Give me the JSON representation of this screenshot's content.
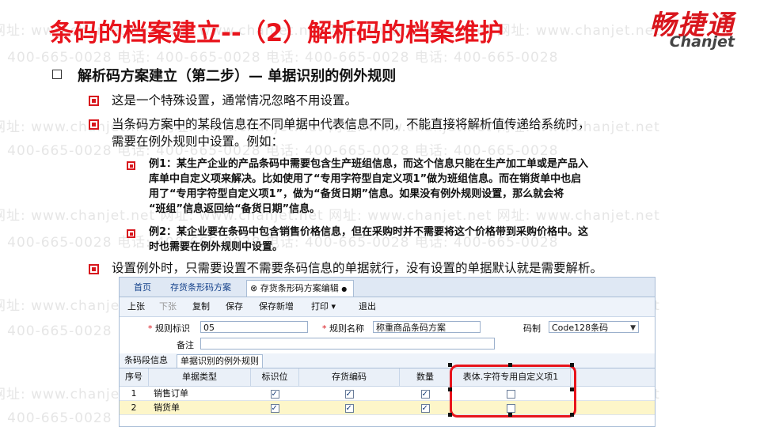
{
  "slide": {
    "title": "条码的档案建立--（2）解析码的档案维护",
    "logo_cn": "畅捷通",
    "logo_en": "Chanjet",
    "watermark": [
      "网址: www.chanjet.net",
      "电话: 400-665-0028"
    ],
    "heading": "解析码方案建立（第二步）— 单据识别的例外规则",
    "points": [
      "这是一个特殊设置，通常情况忽略不用设置。",
      "当条码方案中的某段信息在不同单据中代表信息不同，不能直接将解析值传递给系统时，",
      "需要在例外规则中设置。例如："
    ],
    "examples": [
      "例1：某生产企业的产品条码中需要包含生产班组信息，而这个信息只能在生产加工单或是产品入",
      "库单中自定义项来解决。比如使用了“专用字符型自定义项1”做为班组信息。而在销货单中也启",
      "用了“专用字符型自定义项1”，做为“备货日期”信息。如果没有例外规则设置，那么就会将",
      "“班组”信息返回给“备货日期”信息。",
      "例2：某企业要在条码中包含销售价格信息，但在采购时并不需要将这个价格带到采购价格中。这",
      "时也需要在例外规则中设置。"
    ],
    "last_point": "设置例外时，只需要设置不需要条码信息的单据就行，没有设置的单据默认就是需要解析。"
  },
  "app": {
    "tabs": [
      "首页",
      "存货条形码方案",
      "存货条形码方案编辑"
    ],
    "tab_close_glyph": "⊗",
    "toolbar": [
      "上张",
      "下张",
      "复制",
      "保存",
      "保存新增",
      "打印 ▾",
      "退出"
    ],
    "form": {
      "rule_id_label": "规则标识",
      "rule_id_value": "05",
      "rule_name_label": "规则名称",
      "rule_name_value": "称重商品条码方案",
      "codetype_label": "码制",
      "codetype_value": "Code128条码",
      "note_label": "备注",
      "required_mark": "*"
    },
    "subtabs": [
      "条码段信息",
      "单据识别的例外规则"
    ],
    "grid": {
      "headers": [
        "序号",
        "单据类型",
        "标识位",
        "存货编码",
        "数量",
        "表体.字符专用自定义项1"
      ],
      "rows": [
        {
          "no": "1",
          "type": "销售订单",
          "flags": [
            true,
            true,
            true,
            false
          ]
        },
        {
          "no": "2",
          "type": "销货单",
          "flags": [
            true,
            true,
            true,
            false
          ]
        }
      ]
    }
  }
}
